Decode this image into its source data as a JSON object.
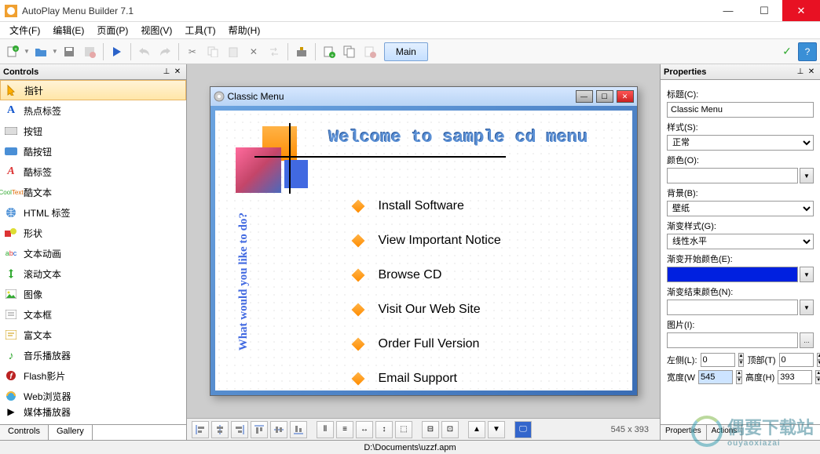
{
  "app": {
    "title": "AutoPlay Menu Builder 7.1"
  },
  "menu": {
    "file": "文件(F)",
    "edit": "编辑(E)",
    "page": "页面(P)",
    "view": "视图(V)",
    "tools": "工具(T)",
    "help": "帮助(H)"
  },
  "toolbar": {
    "main": "Main"
  },
  "controls_panel": {
    "title": "Controls",
    "items": [
      "指针",
      "热点标签",
      "按钮",
      "酷按钮",
      "酷标签",
      "酷文本",
      "HTML 标签",
      "形状",
      "文本动画",
      "滚动文本",
      "图像",
      "文本框",
      "富文本",
      "音乐播放器",
      "Flash影片",
      "Web浏览器",
      "媒体播放器"
    ],
    "tabs": {
      "controls": "Controls",
      "gallery": "Gallery"
    }
  },
  "preview": {
    "title": "Classic Menu",
    "heading": "Welcome to sample cd menu",
    "side_text": "What would you like to do?",
    "items": [
      "Install Software",
      "View Important Notice",
      "Browse CD",
      "Visit Our Web Site",
      "Order Full Version",
      "Email Support"
    ],
    "dims": "545 x 393"
  },
  "properties": {
    "title": "Properties",
    "label_title": "标题(C):",
    "value_title": "Classic Menu",
    "label_style": "样式(S):",
    "value_style": "正常",
    "label_color": "颜色(O):",
    "label_bg": "背景(B):",
    "value_bg": "壁纸",
    "label_grad_style": "渐变样式(G):",
    "value_grad_style": "线性水平",
    "label_grad_start": "渐变开始颜色(E):",
    "label_grad_end": "渐变结束颜色(N):",
    "label_image": "图片(I):",
    "label_left": "左侧(L):",
    "value_left": "0",
    "label_top": "顶部(T)",
    "value_top": "0",
    "label_width": "宽度(W",
    "value_width": "545",
    "label_height": "高度(H)",
    "value_height": "393",
    "tabs": {
      "props": "Properties",
      "actions": "Actions"
    }
  },
  "status": {
    "path": "D:\\Documents\\uzzf.apm"
  },
  "watermark": {
    "text": "偶要下载站",
    "sub": "ouyaoxiazai"
  }
}
